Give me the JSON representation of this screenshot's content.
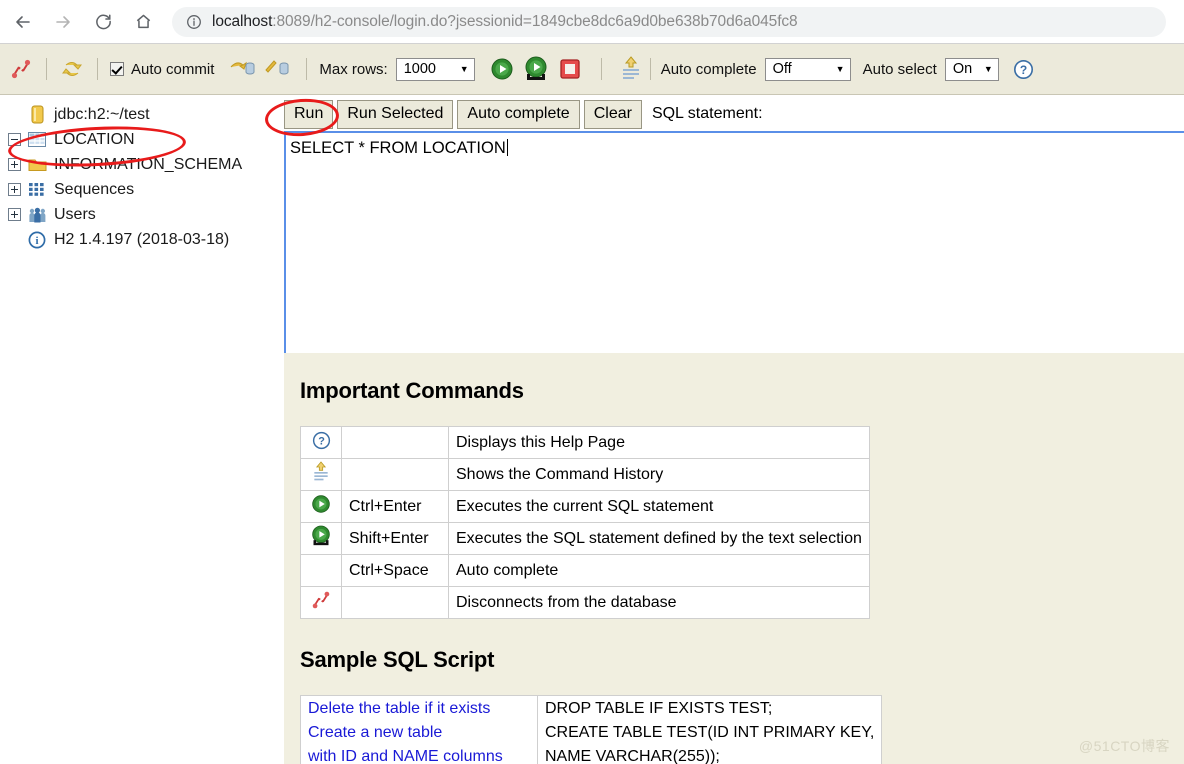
{
  "browser": {
    "back_icon": "arrow-left-icon",
    "forward_icon": "arrow-right-icon",
    "reload_icon": "reload-icon",
    "home_icon": "home-icon",
    "info_icon": "info-circle-icon",
    "url_host": "localhost",
    "url_rest": ":8089/h2-console/login.do?jsessionid=1849cbe8dc6a9d0be638b70d6a045fc8"
  },
  "toolbar": {
    "disconnect_icon": "disconnect-icon",
    "refresh_icon": "refresh-icon",
    "auto_commit_label": "Auto commit",
    "auto_commit_checked": true,
    "rollback_icon": "rollback-icon",
    "commit_icon": "commit-icon",
    "max_rows_label": "Max rows:",
    "max_rows_value": "1000",
    "run_icon": "run-play-icon",
    "run_selected_icon": "run-selected-play-icon",
    "stop_icon": "stop-square-icon",
    "history_icon": "command-history-icon",
    "auto_complete_label": "Auto complete",
    "auto_complete_value": "Off",
    "auto_select_label": "Auto select",
    "auto_select_value": "On",
    "help_icon": "help-circle-icon"
  },
  "sql_bar": {
    "run": "Run",
    "run_selected": "Run Selected",
    "auto_complete": "Auto complete",
    "clear": "Clear",
    "caption": "SQL statement:"
  },
  "editor": {
    "sql_text": "SELECT * FROM LOCATION"
  },
  "tree": {
    "items": [
      {
        "label": "jdbc:h2:~/test",
        "icon": "database-icon",
        "toggle": "none",
        "indent": 0
      },
      {
        "label": "LOCATION",
        "icon": "table-icon",
        "toggle": "minus",
        "indent": 0
      },
      {
        "label": "INFORMATION_SCHEMA",
        "icon": "folder-icon",
        "toggle": "plus",
        "indent": 0
      },
      {
        "label": "Sequences",
        "icon": "sequences-icon",
        "toggle": "plus",
        "indent": 0
      },
      {
        "label": "Users",
        "icon": "users-icon",
        "toggle": "plus",
        "indent": 0
      },
      {
        "label": "H2 1.4.197 (2018-03-18)",
        "icon": "info-icon",
        "toggle": "none",
        "indent": 0
      }
    ]
  },
  "help": {
    "commands_title": "Important Commands",
    "commands": [
      {
        "icon": "help-circle-icon",
        "key": "",
        "desc": "Displays this Help Page"
      },
      {
        "icon": "command-history-icon",
        "key": "",
        "desc": "Shows the Command History"
      },
      {
        "icon": "run-play-icon",
        "key": "Ctrl+Enter",
        "desc": "Executes the current SQL statement"
      },
      {
        "icon": "run-selected-play-icon",
        "key": "Shift+Enter",
        "desc": "Executes the SQL statement defined by the text selection"
      },
      {
        "icon": "",
        "key": "Ctrl+Space",
        "desc": "Auto complete"
      },
      {
        "icon": "disconnect-icon",
        "key": "",
        "desc": "Disconnects from the database"
      }
    ],
    "script_title": "Sample SQL Script",
    "script_rows": [
      {
        "desc": "Delete the table if it exists",
        "sql": "DROP TABLE IF EXISTS TEST;"
      },
      {
        "desc": "Create a new table",
        "sql": "CREATE TABLE TEST(ID INT PRIMARY KEY,"
      },
      {
        "desc": "with ID and NAME columns",
        "sql": "NAME VARCHAR(255));"
      }
    ]
  },
  "watermark": "@51CTO博客"
}
